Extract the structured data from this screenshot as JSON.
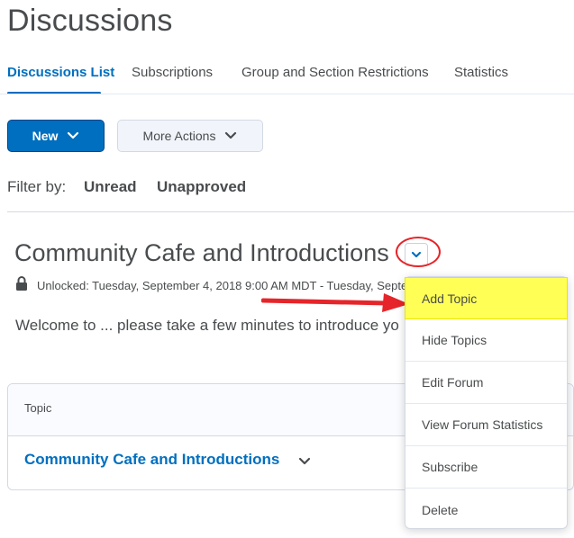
{
  "page": {
    "title": "Discussions"
  },
  "tabs": [
    {
      "label": "Discussions List",
      "active": true
    },
    {
      "label": "Subscriptions",
      "active": false
    },
    {
      "label": "Group and Section Restrictions",
      "active": false
    },
    {
      "label": "Statistics",
      "active": false
    }
  ],
  "toolbar": {
    "new_label": "New",
    "more_actions_label": "More Actions"
  },
  "filter": {
    "label": "Filter by:",
    "options": [
      "Unread",
      "Unapproved"
    ]
  },
  "forum": {
    "title": "Community Cafe and Introductions",
    "unlock_text": "Unlocked: Tuesday, September 4, 2018 9:00 AM MDT - Tuesday, Septe",
    "description": "Welcome to ... please take a few minutes to introduce yo"
  },
  "topics_table": {
    "header": "Topic",
    "rows": [
      {
        "title": "Community Cafe and Introductions"
      }
    ]
  },
  "context_menu": {
    "items": [
      {
        "label": "Add Topic",
        "highlighted": true
      },
      {
        "label": "Hide Topics"
      },
      {
        "label": "Edit Forum"
      },
      {
        "label": "View Forum Statistics"
      },
      {
        "label": "Subscribe"
      },
      {
        "label": "Delete"
      }
    ]
  },
  "colors": {
    "accent": "#006fbf",
    "annotation": "#e5252a",
    "highlight": "#ffff55"
  },
  "icons": [
    "chevron-down-icon",
    "lock-icon",
    "arrow-annotation"
  ]
}
